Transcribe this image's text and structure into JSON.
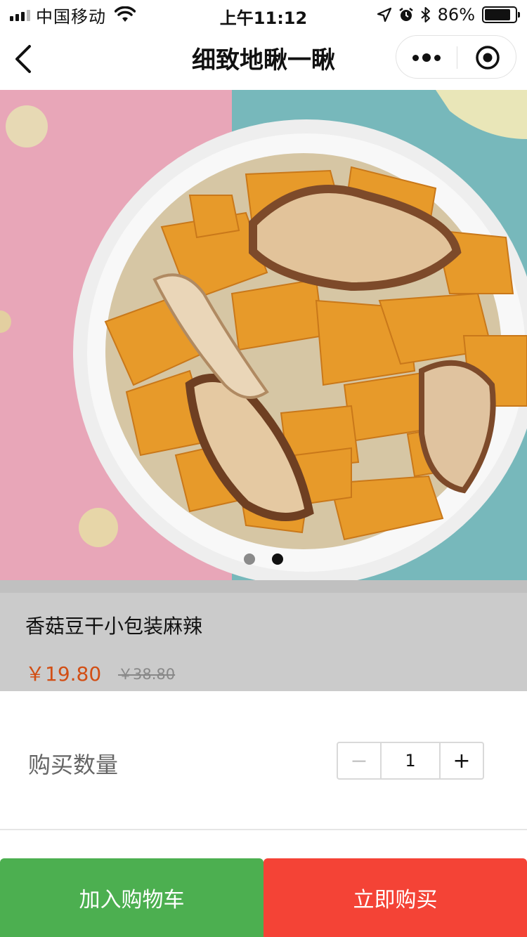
{
  "status_bar": {
    "carrier": "中国移动",
    "time": "上午11:12",
    "battery_percent": "86%",
    "battery_level": 0.86
  },
  "nav": {
    "title": "细致地瞅一瞅",
    "back_icon": "chevron-left-icon",
    "more_icon": "more-dots-icon",
    "close_icon": "target-circle-icon"
  },
  "product": {
    "image_slides": 2,
    "active_slide": 2,
    "name": "香菇豆干小包装麻辣",
    "price": "￥19.80",
    "original_price": "￥38.80"
  },
  "quantity": {
    "label": "购买数量",
    "minus": "−",
    "value": "1",
    "plus": "+"
  },
  "actions": {
    "add_to_cart": "加入购物车",
    "buy_now": "立即购买"
  },
  "colors": {
    "price": "#d24e14",
    "add_to_cart_bg": "#4caf50",
    "buy_now_bg": "#f44336"
  }
}
